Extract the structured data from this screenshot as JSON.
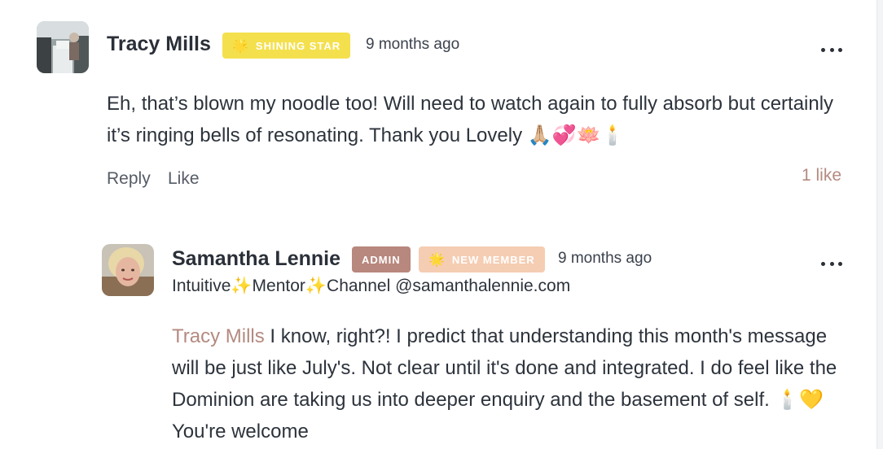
{
  "comment1": {
    "author": "Tracy Mills",
    "badge": {
      "label": "SHINING STAR",
      "icon": "star-icon",
      "color": "#f4e04d"
    },
    "time": "9 months ago",
    "body": "Eh, that’s blown my noodle too! Will need to watch again to fully absorb but certainly it’s ringing bells of resonating. Thank you Lovely 🙏🏼💞🪷🕯️",
    "actions": {
      "reply": "Reply",
      "like": "Like"
    },
    "likes": "1 like"
  },
  "comment2": {
    "author": "Samantha Lennie",
    "admin_badge": {
      "label": "ADMIN",
      "color": "#b8877d"
    },
    "member_badge": {
      "label": "NEW MEMBER",
      "icon": "star-icon",
      "color": "#f5cdb3"
    },
    "time": "9 months ago",
    "headline": "Intuitive✨Mentor✨Channel @samanthalennie.com",
    "mention": "Tracy Mills",
    "body": " I know, right?! I predict that understanding this month's message will be just like July's. Not clear until it's done and integrated. I do feel like the Dominion are taking us into deeper enquiry and the basement of self. 🕯️💛 You're welcome"
  },
  "colors": {
    "accent": "#b48a80",
    "text": "#2d333c"
  }
}
